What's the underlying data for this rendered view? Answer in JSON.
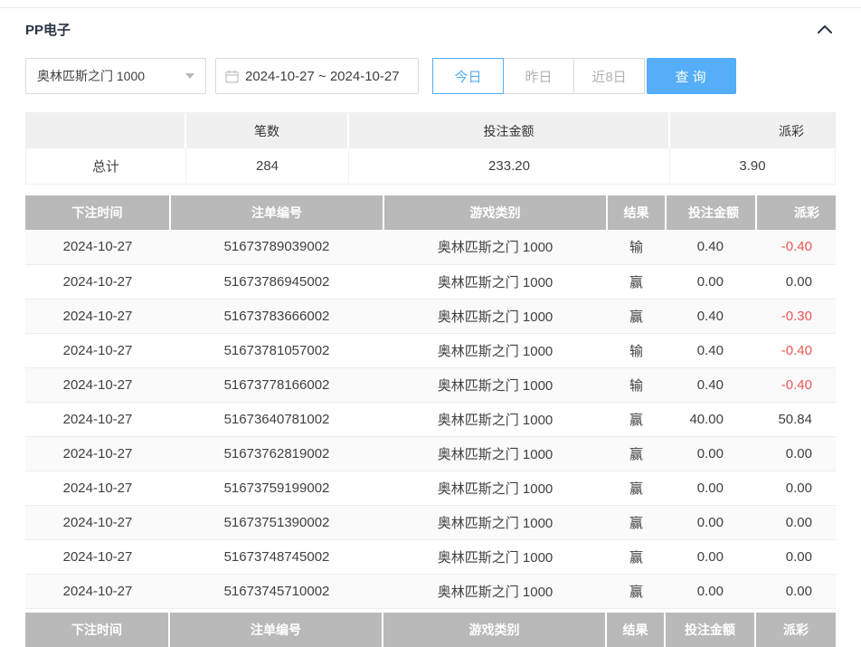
{
  "header": {
    "title": "PP电子"
  },
  "icons": {
    "collapse": "chevron-up-icon",
    "calendar": "calendar-icon",
    "select_caret": "caret-down-icon"
  },
  "filters": {
    "game_select": {
      "value": "奥林匹斯之门 1000"
    },
    "date_range": {
      "value": "2024-10-27 ~ 2024-10-27"
    },
    "quick_buttons": [
      {
        "label": "今日",
        "active": true
      },
      {
        "label": "昨日",
        "active": false
      },
      {
        "label": "近8日",
        "active": false
      }
    ],
    "search_button_label": "查询"
  },
  "summary": {
    "columns": [
      "",
      "笔数",
      "投注金额",
      "派彩"
    ],
    "row_label": "总计",
    "count": "284",
    "bet_amount": "233.20",
    "payout": "3.90"
  },
  "table": {
    "columns": [
      "下注时间",
      "注单编号",
      "游戏类别",
      "结果",
      "投注金额",
      "派彩"
    ],
    "rows": [
      {
        "date": "2024-10-27",
        "bet_id": "51673789039002",
        "game": "奥林匹斯之门 1000",
        "result": "输",
        "amount": "0.40",
        "payout": "-0.40"
      },
      {
        "date": "2024-10-27",
        "bet_id": "51673786945002",
        "game": "奥林匹斯之门 1000",
        "result": "赢",
        "amount": "0.00",
        "payout": "0.00"
      },
      {
        "date": "2024-10-27",
        "bet_id": "51673783666002",
        "game": "奥林匹斯之门 1000",
        "result": "赢",
        "amount": "0.40",
        "payout": "-0.30"
      },
      {
        "date": "2024-10-27",
        "bet_id": "51673781057002",
        "game": "奥林匹斯之门 1000",
        "result": "输",
        "amount": "0.40",
        "payout": "-0.40"
      },
      {
        "date": "2024-10-27",
        "bet_id": "51673778166002",
        "game": "奥林匹斯之门 1000",
        "result": "输",
        "amount": "0.40",
        "payout": "-0.40"
      },
      {
        "date": "2024-10-27",
        "bet_id": "51673640781002",
        "game": "奥林匹斯之门 1000",
        "result": "赢",
        "amount": "40.00",
        "payout": "50.84"
      },
      {
        "date": "2024-10-27",
        "bet_id": "51673762819002",
        "game": "奥林匹斯之门 1000",
        "result": "赢",
        "amount": "0.00",
        "payout": "0.00"
      },
      {
        "date": "2024-10-27",
        "bet_id": "51673759199002",
        "game": "奥林匹斯之门 1000",
        "result": "赢",
        "amount": "0.00",
        "payout": "0.00"
      },
      {
        "date": "2024-10-27",
        "bet_id": "51673751390002",
        "game": "奥林匹斯之门 1000",
        "result": "赢",
        "amount": "0.00",
        "payout": "0.00"
      },
      {
        "date": "2024-10-27",
        "bet_id": "51673748745002",
        "game": "奥林匹斯之门 1000",
        "result": "赢",
        "amount": "0.00",
        "payout": "0.00"
      },
      {
        "date": "2024-10-27",
        "bet_id": "51673745710002",
        "game": "奥林匹斯之门 1000",
        "result": "赢",
        "amount": "0.00",
        "payout": "0.00"
      }
    ]
  },
  "colors": {
    "accent": "#55aef7",
    "negative": "#f05555",
    "thead-bg": "#b9b9b9",
    "summary-header-bg": "#f0f0f0",
    "title-color": "#2b3347",
    "text-color": "#404040",
    "muted-color": "#b3b3b3",
    "border-color": "#d9d9d9",
    "row-border": "#ededed"
  }
}
